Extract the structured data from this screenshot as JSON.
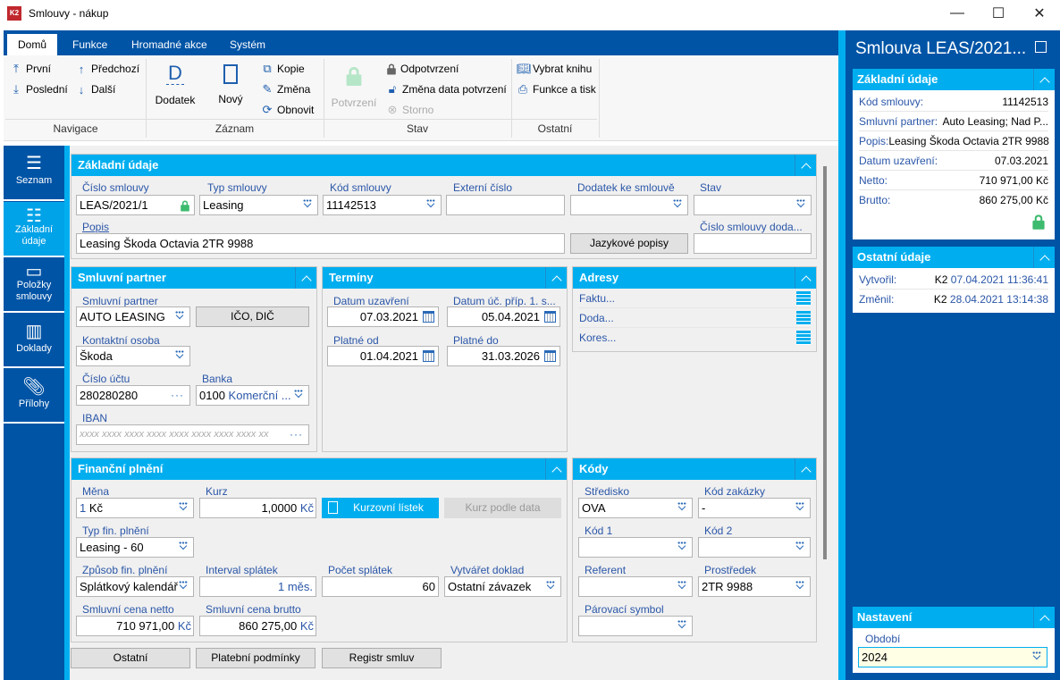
{
  "window": {
    "title": "Smlouvy - nákup",
    "minimize": "—",
    "maximize": "☐",
    "close": "✕"
  },
  "ribbon": {
    "tabs": [
      "Domů",
      "Funkce",
      "Hromadné akce",
      "Systém"
    ],
    "navigace": {
      "prvni": "První",
      "posledni": "Poslední",
      "predchozi": "Předchozí",
      "dalsi": "Další",
      "label": "Navigace"
    },
    "zaznam": {
      "dodatek": "Dodatek",
      "novy": "Nový",
      "kopie": "Kopie",
      "zmena": "Změna",
      "obnovit": "Obnovit",
      "label": "Záznam"
    },
    "stav": {
      "potvrzeni": "Potvrzení",
      "odpotvrzeni": "Odpotvrzení",
      "zmena_data": "Změna data potvrzení",
      "storno": "Storno",
      "label": "Stav"
    },
    "ostatni": {
      "vybrat_knihu": "Vybrat knihu",
      "funkce_tisk": "Funkce a tisk",
      "label": "Ostatní"
    }
  },
  "sidebar": {
    "items": [
      {
        "label": "Seznam",
        "icon": "list-icon"
      },
      {
        "label": "Základní údaje",
        "icon": "details-icon",
        "active": true
      },
      {
        "label": "Položky smlouvy",
        "icon": "box-icon"
      },
      {
        "label": "Doklady",
        "icon": "documents-icon"
      },
      {
        "label": "Přílohy",
        "icon": "paperclip-icon"
      }
    ]
  },
  "zakladni": {
    "title": "Základní údaje",
    "cislo_label": "Číslo smlouvy",
    "cislo": "LEAS/2021/1",
    "typ_label": "Typ smlouvy",
    "typ": "Leasing",
    "kod_label": "Kód smlouvy",
    "kod": "11142513",
    "externi_label": "Externí číslo",
    "externi": "",
    "dodatek_label": "Dodatek ke smlouvě",
    "dodatek": "",
    "stav_label": "Stav",
    "stav": "",
    "popis_label": "Popis",
    "popis": "Leasing Škoda Octavia 2TR 9988",
    "jazykove": "Jazykové popisy",
    "cislo_dod_label": "Číslo smlouvy doda...",
    "cislo_dod": ""
  },
  "partner": {
    "title": "Smluvní partner",
    "partner_label": "Smluvní partner",
    "partner": "AUTO LEASING",
    "ico": "IČO, DIČ",
    "kontakt_label": "Kontaktní osoba",
    "kontakt": "Škoda",
    "ucet_label": "Číslo účtu",
    "ucet": "280280280",
    "banka_label": "Banka",
    "banka_code": "0100",
    "banka_name": "Komerční ...",
    "iban_label": "IBAN",
    "iban_placeholder": "xxxx xxxx xxxx xxxx xxxx xxxx xxxx xxxx xx"
  },
  "terminy": {
    "title": "Termíny",
    "uzavreni_label": "Datum uzavření",
    "uzavreni": "07.03.2021",
    "ucp_label": "Datum úč. příp. 1. s...",
    "ucp": "05.04.2021",
    "od_label": "Platné od",
    "od": "01.04.2021",
    "do_label": "Platné do",
    "do": "31.03.2026"
  },
  "adresy": {
    "title": "Adresy",
    "items": [
      "Faktu...",
      "Doda...",
      "Kores..."
    ]
  },
  "financni": {
    "title": "Finanční plnění",
    "mena_label": "Měna",
    "mena_num": "1",
    "mena": "Kč",
    "kurz_label": "Kurz",
    "kurz": "1,0000",
    "kurz_unit": "Kč",
    "kurzovni": "Kurzovní lístek",
    "kurz_data": "Kurz podle data",
    "typ_label": "Typ fin. plnění",
    "typ": "Leasing - 60",
    "zpusob_label": "Způsob fin. plnění",
    "zpusob": "Splátkový kalendář",
    "interval_label": "Interval splátek",
    "interval": "1 měs.",
    "pocet_label": "Počet splátek",
    "pocet": "60",
    "vytvaret_label": "Vytvářet doklad",
    "vytvaret": "Ostatní závazek",
    "netto_label": "Smluvní cena netto",
    "netto": "710 971,00",
    "brutto_label": "Smluvní cena brutto",
    "brutto": "860 275,00",
    "unit": "Kč"
  },
  "kody": {
    "title": "Kódy",
    "stredisko_label": "Středisko",
    "stredisko": "OVA",
    "zakazka_label": "Kód zakázky",
    "zakazka": "-",
    "kod1_label": "Kód 1",
    "kod1": "",
    "kod2_label": "Kód 2",
    "kod2": "",
    "referent_label": "Referent",
    "referent": "",
    "prostredek_label": "Prostředek",
    "prostredek": "2TR 9988",
    "parovaci_label": "Párovací symbol",
    "parovaci": ""
  },
  "bottom_buttons": [
    "Ostatní",
    "Platební podmínky",
    "Registr smluv"
  ],
  "right_panel": {
    "title": "Smlouva LEAS/2021...",
    "zakladni": {
      "title": "Základní údaje",
      "rows": [
        {
          "k": "Kód smlouvy:",
          "v": "11142513"
        },
        {
          "k": "Smluvní partner:",
          "v": "Auto Leasing; Nad P..."
        },
        {
          "k": "Popis:",
          "v": "Leasing Škoda Octavia 2TR 9988"
        },
        {
          "k": "Datum uzavření:",
          "v": "07.03.2021"
        },
        {
          "k": "Netto:",
          "v": "710 971,00 Kč"
        },
        {
          "k": "Brutto:",
          "v": "860 275,00 Kč"
        }
      ]
    },
    "ostatni": {
      "title": "Ostatní údaje",
      "rows": [
        {
          "k": "Vytvořil:",
          "user": "K2",
          "v": "07.04.2021 11:36:41"
        },
        {
          "k": "Změnil:",
          "user": "K2",
          "v": "28.04.2021 13:14:38"
        }
      ]
    },
    "nastaveni": {
      "title": "Nastavení",
      "obdobi_label": "Období",
      "obdobi": "2024"
    }
  },
  "colors": {
    "dark_blue": "#0054a6",
    "accent": "#00aeef",
    "lock_green": "#3dbb6e"
  }
}
